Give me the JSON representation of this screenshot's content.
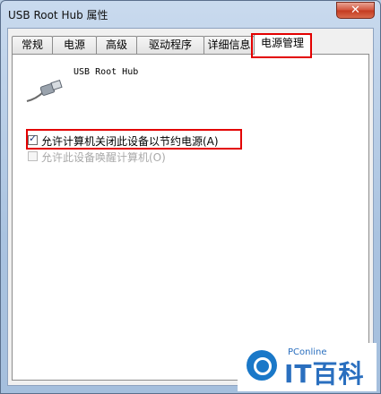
{
  "window": {
    "title": "USB Root Hub 属性",
    "close_glyph": "✕"
  },
  "tabs": [
    {
      "label": "常规"
    },
    {
      "label": "电源"
    },
    {
      "label": "高级"
    },
    {
      "label": "驱动程序"
    },
    {
      "label": "详细信息"
    },
    {
      "label": "电源管理",
      "active": true
    }
  ],
  "device": {
    "name": "USB Root Hub",
    "icon": "usb-plug-icon"
  },
  "options": [
    {
      "label": "允许计算机关闭此设备以节约电源(A)",
      "checked": true,
      "enabled": true
    },
    {
      "label": "允许此设备唤醒计算机(O)",
      "checked": false,
      "enabled": false
    }
  ],
  "watermark": {
    "small": "PConline",
    "big": "IT百科"
  },
  "colors": {
    "highlight": "#e30000",
    "brand": "#2a6fbf"
  }
}
